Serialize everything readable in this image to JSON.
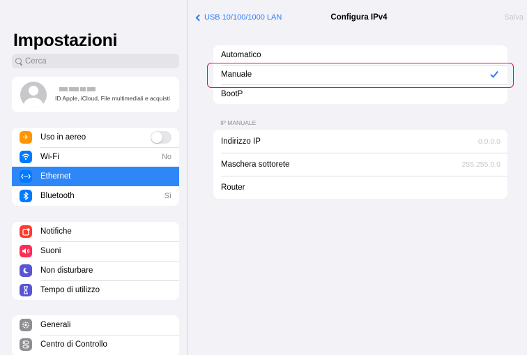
{
  "sidebar": {
    "title": "Impostazioni",
    "search_placeholder": "Cerca",
    "profile": {
      "subtitle": "ID Apple, iCloud, File multimediali e acquisti"
    },
    "network_items": [
      {
        "label": "Uso in aereo",
        "value": "",
        "icon": "airplane-icon",
        "color": "#ff9500"
      },
      {
        "label": "Wi-Fi",
        "value": "No",
        "icon": "wifi-icon",
        "color": "#007aff"
      },
      {
        "label": "Ethernet",
        "value": "",
        "icon": "ethernet-icon",
        "color": "#007aff"
      },
      {
        "label": "Bluetooth",
        "value": "Sì",
        "icon": "bluetooth-icon",
        "color": "#007aff"
      }
    ],
    "notif_items": [
      {
        "label": "Notifiche",
        "icon": "notifications-icon",
        "color": "#ff3b30"
      },
      {
        "label": "Suoni",
        "icon": "sounds-icon",
        "color": "#ff2d55"
      },
      {
        "label": "Non disturbare",
        "icon": "moon-icon",
        "color": "#5856d6"
      },
      {
        "label": "Tempo di utilizzo",
        "icon": "hourglass-icon",
        "color": "#5856d6"
      }
    ],
    "general_items": [
      {
        "label": "Generali",
        "icon": "gear-icon",
        "color": "#8e8e93"
      },
      {
        "label": "Centro di Controllo",
        "icon": "control-center-icon",
        "color": "#8e8e93"
      }
    ],
    "airplane_toggle": false,
    "selected": "Ethernet"
  },
  "navbar": {
    "back_label": "USB 10/100/1000 LAN",
    "title": "Configura IPv4",
    "save_label": "Salva"
  },
  "config_options": [
    {
      "label": "Automatico",
      "checked": false
    },
    {
      "label": "Manuale",
      "checked": true
    },
    {
      "label": "BootP",
      "checked": false
    }
  ],
  "manual": {
    "section_label": "IP MANUALE",
    "fields": [
      {
        "label": "Indirizzo IP",
        "placeholder": "0.0.0.0"
      },
      {
        "label": "Maschera sottorete",
        "placeholder": "255.255.0.0"
      },
      {
        "label": "Router",
        "placeholder": ""
      }
    ]
  },
  "colors": {
    "accent": "#2f87f7",
    "highlight": "#d11f2e"
  }
}
